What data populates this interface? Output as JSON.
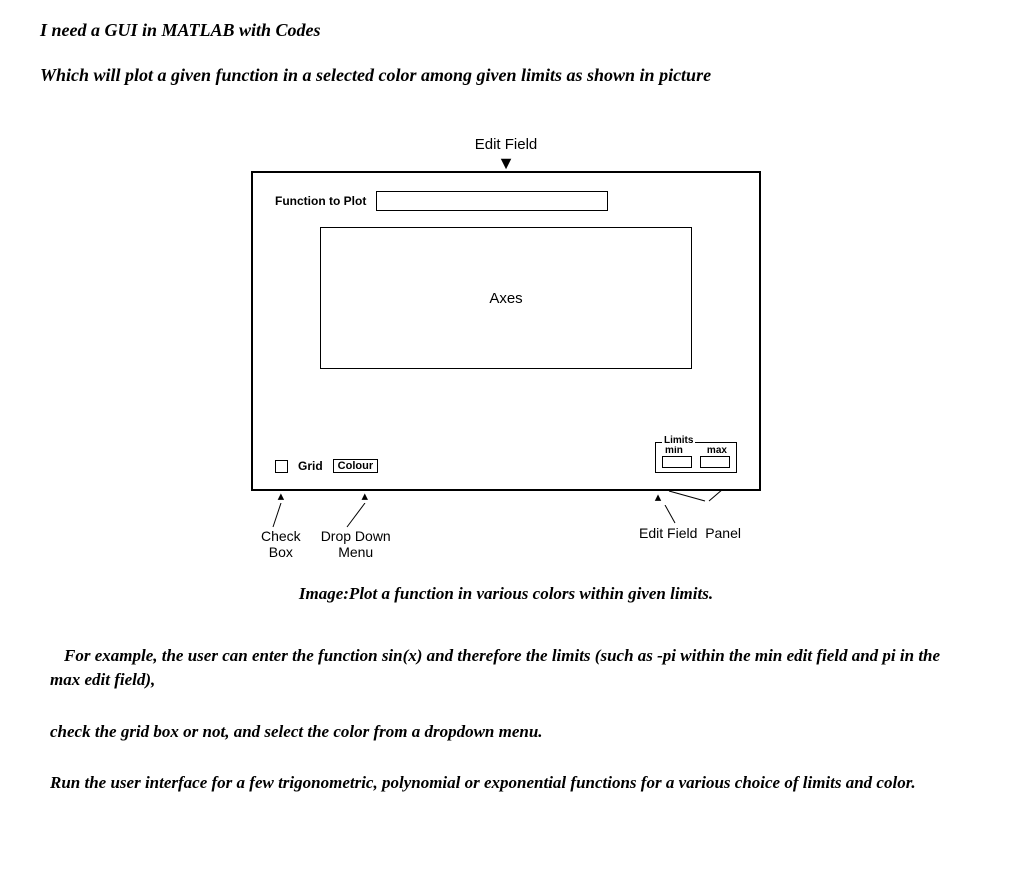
{
  "title1": "I need  a GUI in MATLAB with Codes",
  "title2": "Which will plot a given function in a selected color among given limits as shown in picture",
  "mockup": {
    "edit_field_label": "Edit Field",
    "function_label": "Function to Plot",
    "axes_label": "Axes",
    "grid_label": "Grid",
    "colour_label": "Colour",
    "limits_legend": "Limits",
    "min_label": "min",
    "max_label": "max"
  },
  "annotations": {
    "checkbox": "Check\nBox",
    "dropdown": "Drop Down\nMenu",
    "editfield": "Edit Field",
    "panel": "Panel"
  },
  "caption": "Image:Plot a function in various colors within given limits.",
  "para1": "For example, the user can enter the function sin(x) and therefore the limits (such as -pi within the min edit field and pi in the max edit field),",
  "para2": "check the grid box or not, and select the color from a dropdown menu.",
  "para3": "Run the user interface for a few trigonometric, polynomial or exponential functions for a various choice of limits and color."
}
